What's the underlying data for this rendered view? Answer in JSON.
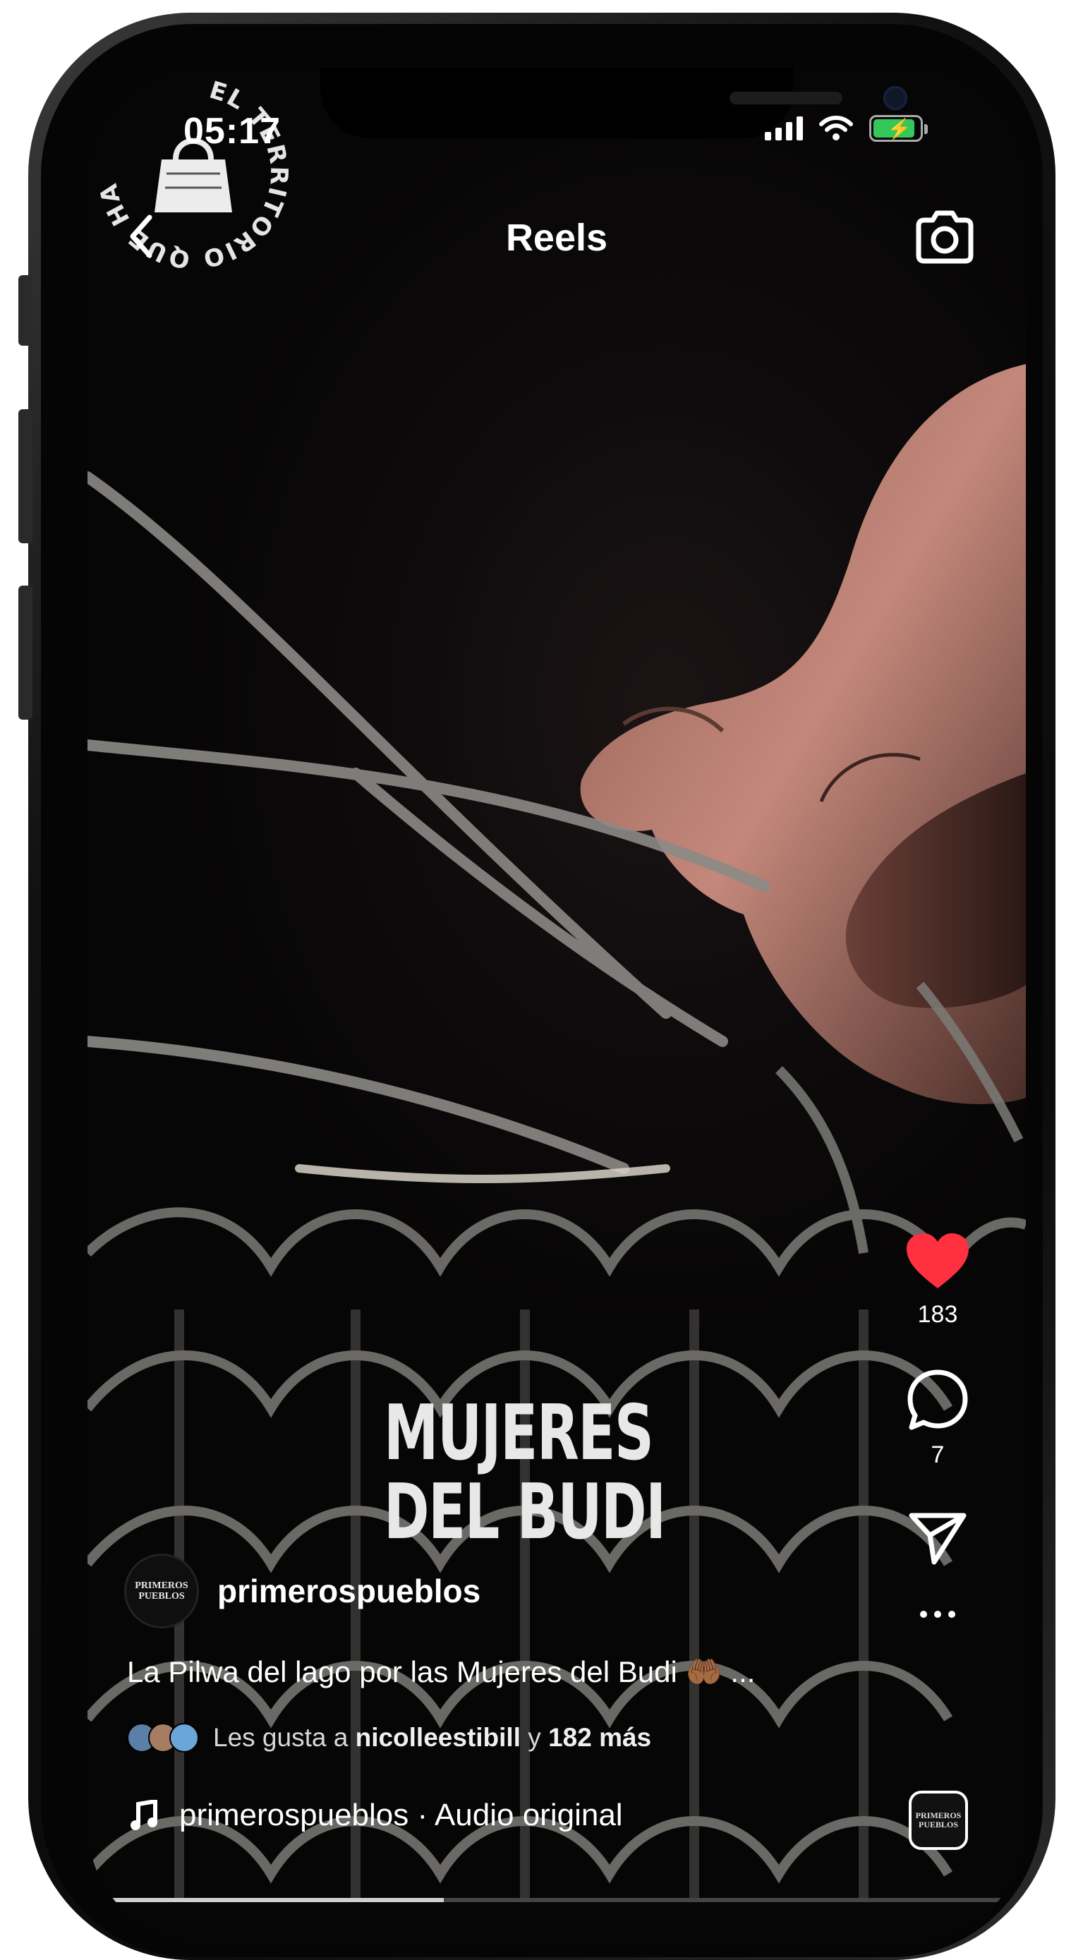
{
  "status_bar": {
    "time": "05:17"
  },
  "header": {
    "title": "Reels",
    "back_icon": "chevron-left-icon",
    "camera_icon": "camera-icon"
  },
  "video": {
    "logo_ring_text": "EL TERRITORIO QUE HABLA",
    "title_line1": "MUJERES",
    "title_line2": "DEL BUDI"
  },
  "actions": {
    "like_count": "183",
    "comment_count": "7",
    "like_color": "#ff3040"
  },
  "post": {
    "account_name": "primerospueblos",
    "avatar_text_line1": "PRIMEROS",
    "avatar_text_line2": "PUEBLOS",
    "caption": "La Pilwa del lago por las Mujeres del Budi 🤲🏾 ...",
    "likes_prefix": "Les gusta a ",
    "likes_user": "nicolleestibill",
    "likes_middle": " y ",
    "likes_rest": "182 más",
    "audio_label": "primerospueblos · Audio original",
    "audio_thumb_line1": "PRIMEROS",
    "audio_thumb_line2": "PUEBLOS"
  },
  "progress": {
    "fraction": 0.38
  }
}
